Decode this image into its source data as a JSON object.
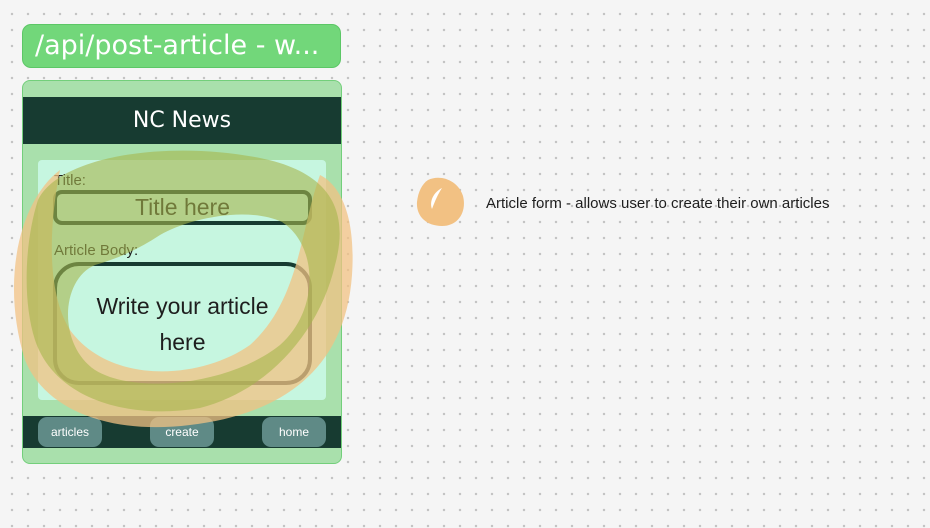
{
  "frame": {
    "label": "/api/post-article - w..."
  },
  "app": {
    "header_title": "NC News",
    "form": {
      "title_label": "Title:",
      "title_placeholder": "Title here",
      "body_label": "Article Body:",
      "body_placeholder": "Write your article here"
    },
    "nav": {
      "articles": "articles",
      "create": "create",
      "home": "home"
    }
  },
  "annotation": {
    "text": "Article form - allows user to create their own articles"
  },
  "colors": {
    "frame_label_bg": "#72d77a",
    "phone_bg": "#a9e0ac",
    "header_bg": "#173b31",
    "form_bg": "#c6f6e0",
    "nav_button_bg": "#5f8a86",
    "highlight_orange": "#f2c183",
    "highlight_olive": "#a6b64c"
  }
}
